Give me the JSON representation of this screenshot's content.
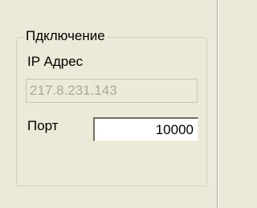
{
  "group": {
    "title": "Пдключение"
  },
  "ip": {
    "label": "IP Адрес",
    "value": "217.8.231.143"
  },
  "port": {
    "label": "Порт",
    "value": "10000"
  }
}
